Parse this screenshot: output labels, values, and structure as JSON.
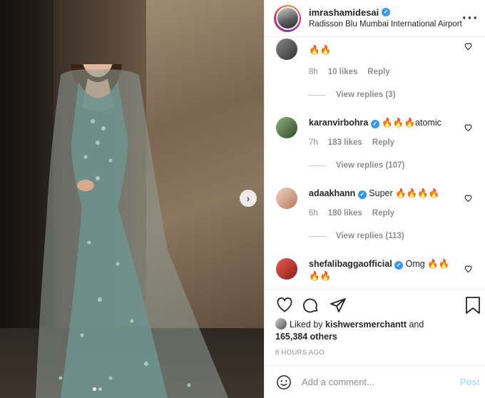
{
  "post": {
    "username": "imrashamidesai",
    "location": "Radisson Blu Mumbai International Airport",
    "more_icon": "more-icon"
  },
  "comments": [
    {
      "user": "",
      "text": "🔥🔥",
      "time": "8h",
      "likes": "10 likes",
      "reply": "Reply",
      "view_replies": "View replies (3)"
    },
    {
      "user": "karanvirbohra",
      "verified": true,
      "text": "🔥🔥🔥atomic",
      "time": "7h",
      "likes": "183 likes",
      "reply": "Reply",
      "view_replies": "View replies (107)"
    },
    {
      "user": "adaakhann",
      "verified": true,
      "text": "Super 🔥🔥🔥🔥",
      "time": "6h",
      "likes": "180 likes",
      "reply": "Reply",
      "view_replies": "View replies (113)"
    },
    {
      "user": "shefalibaggaofficial",
      "verified": true,
      "text": "Omg 🔥🔥",
      "text2": "🔥🔥"
    }
  ],
  "likes": {
    "prefix": "Liked by",
    "user": "kishwersmerchantt",
    "and": "and",
    "count": "165,384 others"
  },
  "timestamp": "8 HOURS AGO",
  "add_comment": {
    "placeholder": "Add a comment...",
    "post_label": "Post"
  },
  "colors": {
    "verified": "#3897f0",
    "muted": "#8e8e8e",
    "post_disabled": "#b2dffc"
  }
}
